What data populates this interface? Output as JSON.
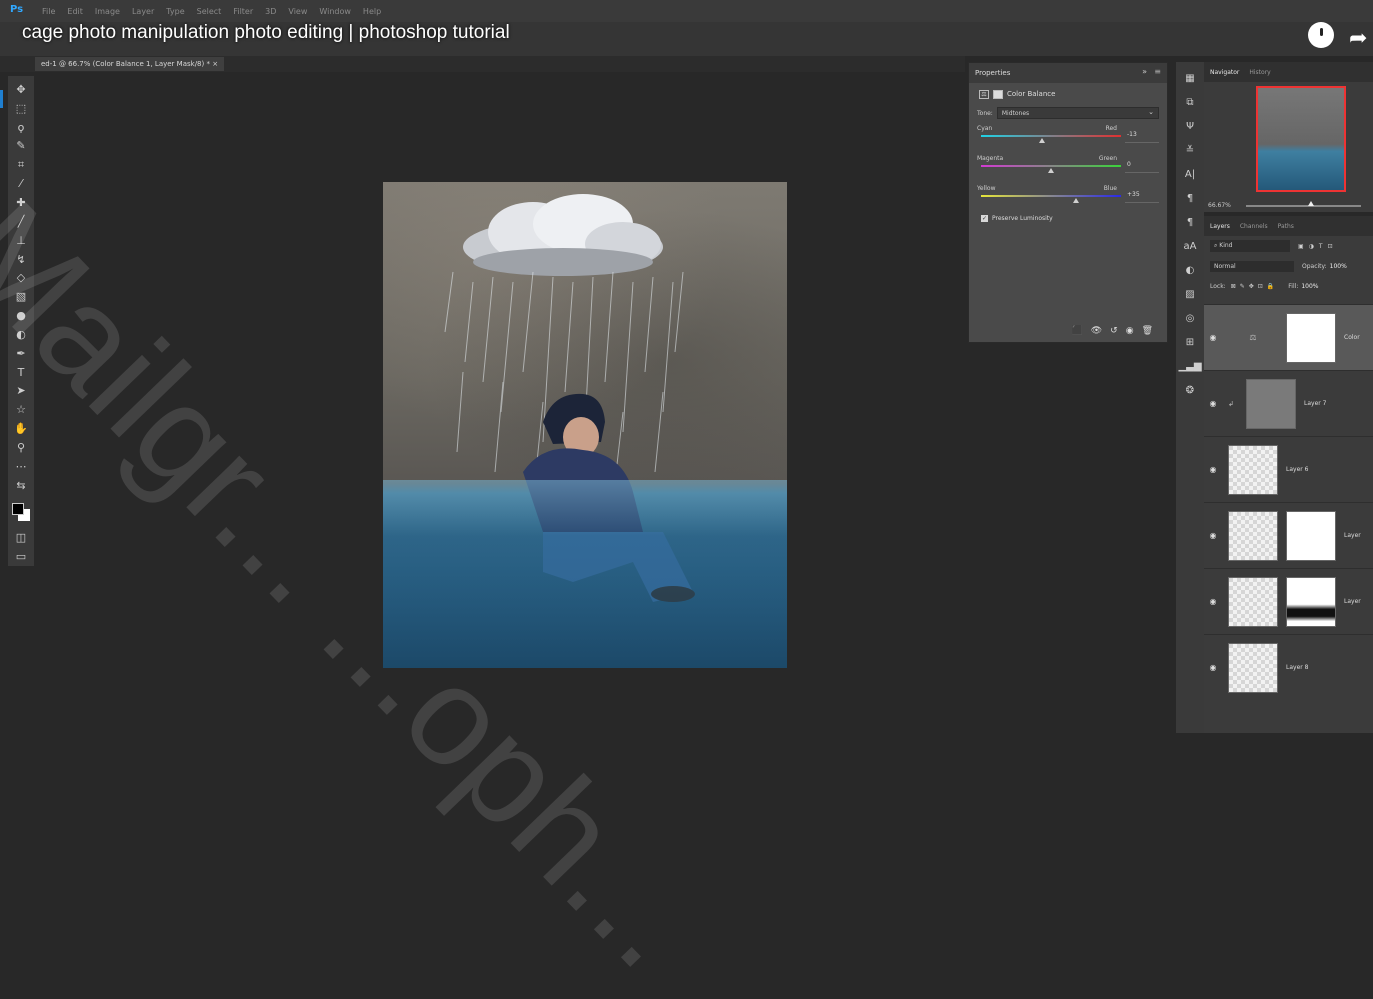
{
  "app": {
    "logo": "Ps"
  },
  "menu": [
    "File",
    "Edit",
    "Image",
    "Layer",
    "Type",
    "Select",
    "Filter",
    "3D",
    "View",
    "Window",
    "Help"
  ],
  "video": {
    "title": "cage photo manipulation photo editing | photoshop tutorial"
  },
  "document": {
    "tab_label": "ed-1 @ 66.7% (Color Balance 1, Layer Mask/8) *",
    "close": "×"
  },
  "properties": {
    "panel_title": "Properties",
    "collapse": "»",
    "adjustment": "Color Balance",
    "tone_label": "Tone:",
    "tone_value": "Midtones",
    "sliders": [
      {
        "left": "Cyan",
        "right": "Red",
        "value": "-13",
        "level": -13
      },
      {
        "left": "Magenta",
        "right": "Green",
        "value": "0",
        "level": 0
      },
      {
        "left": "Yellow",
        "right": "Blue",
        "value": "+35",
        "level": 35
      }
    ],
    "preserve_label": "Preserve Luminosity",
    "preserve_checked": true
  },
  "navigator": {
    "tabs": [
      "Navigator",
      "History"
    ],
    "zoom": "66.67%"
  },
  "layers": {
    "tabs": [
      "Layers",
      "Channels",
      "Paths"
    ],
    "kind_label": "Kind",
    "blend_mode": "Normal",
    "opacity_label": "Opacity:",
    "opacity_value": "100%",
    "lock_label": "Lock:",
    "fill_label": "Fill:",
    "fill_value": "100%",
    "items": [
      {
        "name": "Color",
        "type": "adjustment"
      },
      {
        "name": "Layer 7",
        "type": "clipped"
      },
      {
        "name": "Layer 6",
        "type": "pixel"
      },
      {
        "name": "Layer",
        "type": "masked"
      },
      {
        "name": "Layer",
        "type": "masked"
      },
      {
        "name": "Layer 8",
        "type": "pixel"
      }
    ]
  },
  "watermark": {
    "text": "Mailgr... ...oph..."
  },
  "colors": {
    "accent": "#31a8ff",
    "selection_border": "#e33333"
  }
}
